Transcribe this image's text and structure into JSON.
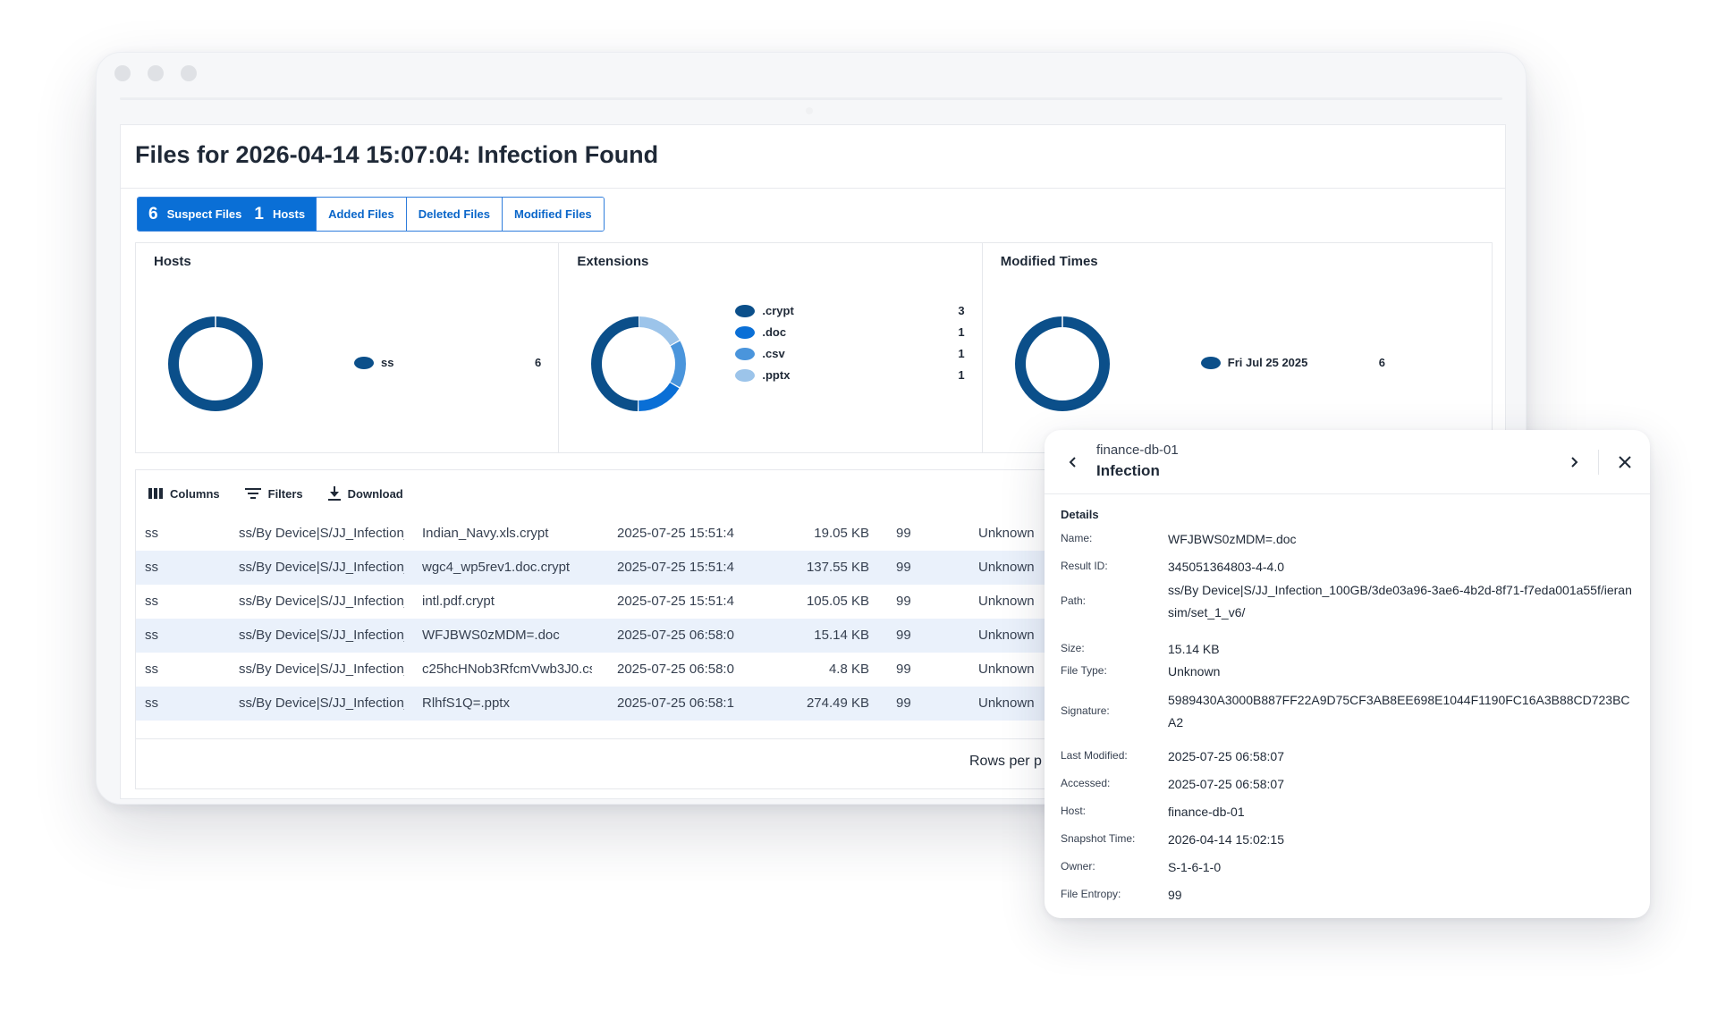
{
  "page": {
    "title": "Files for 2026-04-14 15:07:04: Infection Found"
  },
  "tabs": {
    "suspect_count": "6",
    "suspect_label": "Suspect Files",
    "hosts_count": "1",
    "hosts_label": "Hosts",
    "added": "Added Files",
    "deleted": "Deleted Files",
    "modified": "Modified Files"
  },
  "panels": {
    "hosts": {
      "title": "Hosts",
      "legend": [
        {
          "label": "ss",
          "value": "6",
          "color": "#0b4f8a"
        }
      ]
    },
    "extensions": {
      "title": "Extensions",
      "legend": [
        {
          "label": ".crypt",
          "value": "3",
          "color": "#0b4f8a"
        },
        {
          "label": ".doc",
          "value": "1",
          "color": "#0a6fd6"
        },
        {
          "label": ".csv",
          "value": "1",
          "color": "#4a95dc"
        },
        {
          "label": ".pptx",
          "value": "1",
          "color": "#9cc4ea"
        }
      ]
    },
    "modified_times": {
      "title": "Modified Times",
      "legend": [
        {
          "label": "Fri Jul 25 2025",
          "value": "6",
          "color": "#0b4f8a"
        }
      ]
    }
  },
  "toolbar": {
    "columns": "Columns",
    "filters": "Filters",
    "download": "Download"
  },
  "table": {
    "rows": [
      [
        "ss",
        "ss/By Device|S/JJ_Infection_",
        "Indian_Navy.xls.crypt",
        "2025-07-25 15:51:4",
        "19.05 KB",
        "99",
        "Unknown"
      ],
      [
        "ss",
        "ss/By Device|S/JJ_Infection_",
        "wgc4_wp5rev1.doc.crypt",
        "2025-07-25 15:51:4",
        "137.55 KB",
        "99",
        "Unknown"
      ],
      [
        "ss",
        "ss/By Device|S/JJ_Infection_",
        "intl.pdf.crypt",
        "2025-07-25 15:51:4",
        "105.05 KB",
        "99",
        "Unknown"
      ],
      [
        "ss",
        "ss/By Device|S/JJ_Infection_",
        "WFJBWS0zMDM=.doc",
        "2025-07-25 06:58:0",
        "15.14 KB",
        "99",
        "Unknown"
      ],
      [
        "ss",
        "ss/By Device|S/JJ_Infection_",
        "c25hcHNob3RfcmVwb3J0.cs",
        "2025-07-25 06:58:0",
        "4.8 KB",
        "99",
        "Unknown"
      ],
      [
        "ss",
        "ss/By Device|S/JJ_Infection_",
        "RlhfS1Q=.pptx",
        "2025-07-25 06:58:1",
        "274.49 KB",
        "99",
        "Unknown"
      ]
    ],
    "rows_per_page": "Rows per p"
  },
  "detail": {
    "host": "finance-db-01",
    "title": "Infection",
    "section": "Details",
    "fields": [
      {
        "key": "Name:",
        "value": "WFJBWS0zMDM=.doc"
      },
      {
        "key": "Result ID:",
        "value": "345051364803-4-4.0"
      },
      {
        "key": "Path:",
        "value": "ss/By Device|S/JJ_Infection_100GB/3de03a96-3ae6-4b2d-8f71-f7eda001a55f/ieransim/set_1_v6/"
      },
      {
        "key": "Size:",
        "value": "15.14 KB"
      },
      {
        "key": "File Type:",
        "value": "Unknown"
      },
      {
        "key": "Signature:",
        "value": "5989430A3000B887FF22A9D75CF3AB8EE698E1044F1190FC16A3B88CD723BCA2"
      },
      {
        "key": "Last Modified:",
        "value": "2025-07-25 06:58:07"
      },
      {
        "key": "Accessed:",
        "value": "2025-07-25 06:58:07"
      },
      {
        "key": "Host:",
        "value": "finance-db-01"
      },
      {
        "key": "Snapshot Time:",
        "value": "2026-04-14 15:02:15"
      },
      {
        "key": "Owner:",
        "value": "S-1-6-1-0"
      },
      {
        "key": "File Entropy:",
        "value": "99"
      }
    ]
  }
}
